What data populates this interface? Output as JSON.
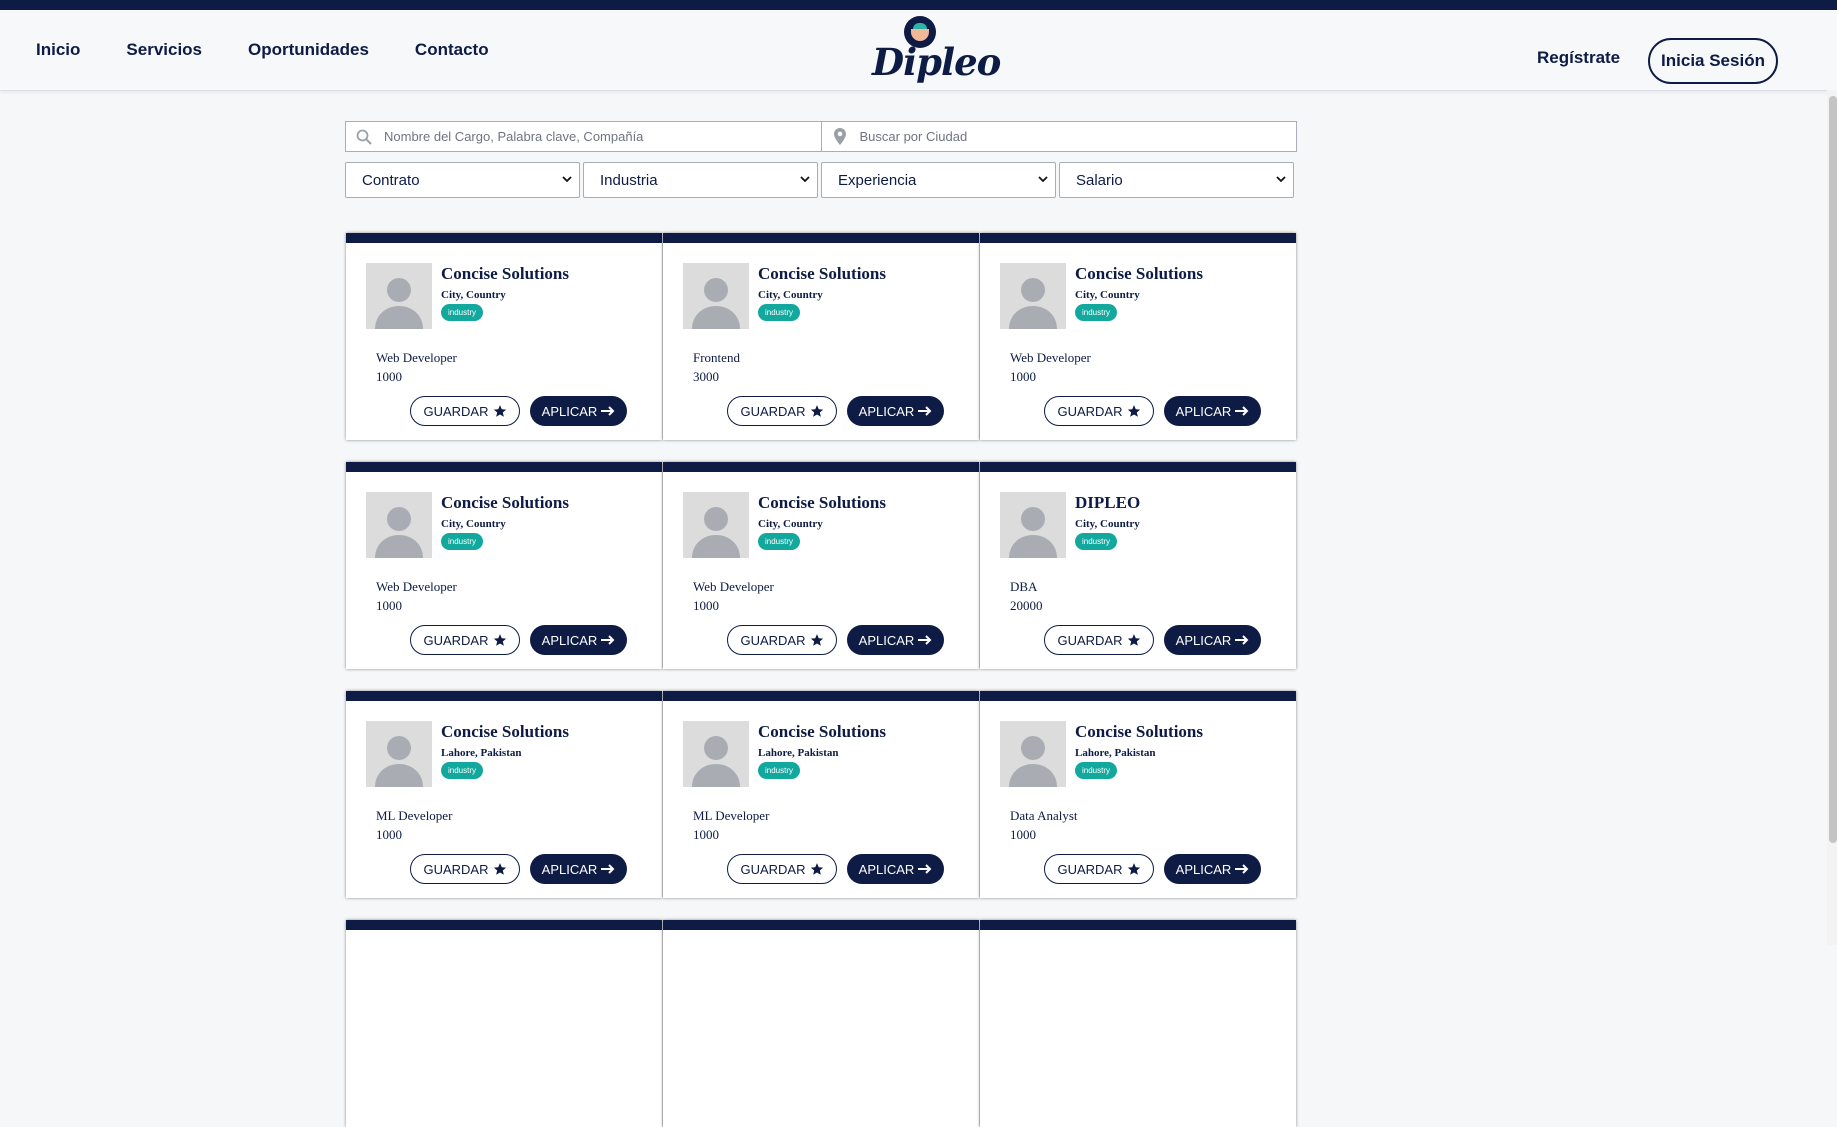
{
  "nav": {
    "links": [
      "Inicio",
      "Servicios",
      "Oportunidades",
      "Contacto"
    ],
    "logo_text": "Dipleo",
    "register_label": "Regístrate",
    "login_label": "Inicia Sesión"
  },
  "search": {
    "keyword_placeholder": "Nombre del Cargo, Palabra clave, Compañía",
    "city_placeholder": "Buscar por Ciudad"
  },
  "filters": [
    "Contrato",
    "Industria",
    "Experiencia",
    "Salario"
  ],
  "card_buttons": {
    "save_label": "GUARDAR",
    "apply_label": "APLICAR"
  },
  "jobs": [
    {
      "company": "Concise Solutions",
      "location": "City, Country",
      "industry": "industry",
      "title": "Web Developer",
      "salary": "1000"
    },
    {
      "company": "Concise Solutions",
      "location": "City, Country",
      "industry": "industry",
      "title": "Frontend",
      "salary": "3000"
    },
    {
      "company": "Concise Solutions",
      "location": "City, Country",
      "industry": "industry",
      "title": "Web Developer",
      "salary": "1000"
    },
    {
      "company": "Concise Solutions",
      "location": "City, Country",
      "industry": "industry",
      "title": "Web Developer",
      "salary": "1000"
    },
    {
      "company": "Concise Solutions",
      "location": "City, Country",
      "industry": "industry",
      "title": "Web Developer",
      "salary": "1000"
    },
    {
      "company": "DIPLEO",
      "location": "City, Country",
      "industry": "industry",
      "title": "DBA",
      "salary": "20000"
    },
    {
      "company": "Concise Solutions",
      "location": "Lahore, Pakistan",
      "industry": "industry",
      "title": "ML Developer",
      "salary": "1000"
    },
    {
      "company": "Concise Solutions",
      "location": "Lahore, Pakistan",
      "industry": "industry",
      "title": "ML Developer",
      "salary": "1000"
    },
    {
      "company": "Concise Solutions",
      "location": "Lahore, Pakistan",
      "industry": "industry",
      "title": "Data Analyst",
      "salary": "1000"
    }
  ],
  "colors": {
    "navy": "#0d1b45",
    "teal": "#13a89e",
    "background": "#f6f7f9"
  },
  "icons": [
    "search-icon",
    "map-pin-icon",
    "chevron-down-icon",
    "star-icon",
    "arrow-right-icon",
    "user-placeholder-icon"
  ]
}
